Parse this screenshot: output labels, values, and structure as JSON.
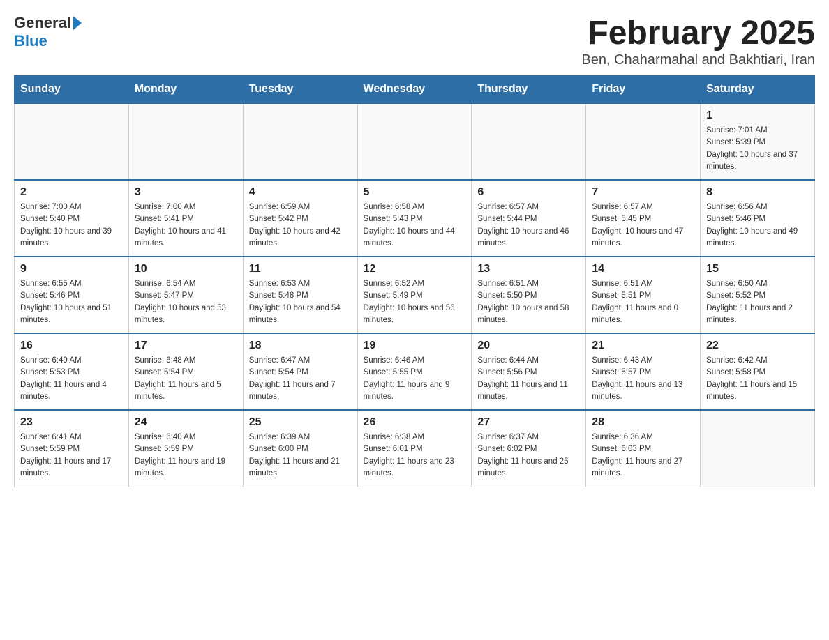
{
  "header": {
    "logo_general": "General",
    "logo_blue": "Blue",
    "month_title": "February 2025",
    "subtitle": "Ben, Chaharmahal and Bakhtiari, Iran"
  },
  "weekdays": [
    "Sunday",
    "Monday",
    "Tuesday",
    "Wednesday",
    "Thursday",
    "Friday",
    "Saturday"
  ],
  "weeks": [
    [
      {
        "day": "",
        "sunrise": "",
        "sunset": "",
        "daylight": ""
      },
      {
        "day": "",
        "sunrise": "",
        "sunset": "",
        "daylight": ""
      },
      {
        "day": "",
        "sunrise": "",
        "sunset": "",
        "daylight": ""
      },
      {
        "day": "",
        "sunrise": "",
        "sunset": "",
        "daylight": ""
      },
      {
        "day": "",
        "sunrise": "",
        "sunset": "",
        "daylight": ""
      },
      {
        "day": "",
        "sunrise": "",
        "sunset": "",
        "daylight": ""
      },
      {
        "day": "1",
        "sunrise": "Sunrise: 7:01 AM",
        "sunset": "Sunset: 5:39 PM",
        "daylight": "Daylight: 10 hours and 37 minutes."
      }
    ],
    [
      {
        "day": "2",
        "sunrise": "Sunrise: 7:00 AM",
        "sunset": "Sunset: 5:40 PM",
        "daylight": "Daylight: 10 hours and 39 minutes."
      },
      {
        "day": "3",
        "sunrise": "Sunrise: 7:00 AM",
        "sunset": "Sunset: 5:41 PM",
        "daylight": "Daylight: 10 hours and 41 minutes."
      },
      {
        "day": "4",
        "sunrise": "Sunrise: 6:59 AM",
        "sunset": "Sunset: 5:42 PM",
        "daylight": "Daylight: 10 hours and 42 minutes."
      },
      {
        "day": "5",
        "sunrise": "Sunrise: 6:58 AM",
        "sunset": "Sunset: 5:43 PM",
        "daylight": "Daylight: 10 hours and 44 minutes."
      },
      {
        "day": "6",
        "sunrise": "Sunrise: 6:57 AM",
        "sunset": "Sunset: 5:44 PM",
        "daylight": "Daylight: 10 hours and 46 minutes."
      },
      {
        "day": "7",
        "sunrise": "Sunrise: 6:57 AM",
        "sunset": "Sunset: 5:45 PM",
        "daylight": "Daylight: 10 hours and 47 minutes."
      },
      {
        "day": "8",
        "sunrise": "Sunrise: 6:56 AM",
        "sunset": "Sunset: 5:46 PM",
        "daylight": "Daylight: 10 hours and 49 minutes."
      }
    ],
    [
      {
        "day": "9",
        "sunrise": "Sunrise: 6:55 AM",
        "sunset": "Sunset: 5:46 PM",
        "daylight": "Daylight: 10 hours and 51 minutes."
      },
      {
        "day": "10",
        "sunrise": "Sunrise: 6:54 AM",
        "sunset": "Sunset: 5:47 PM",
        "daylight": "Daylight: 10 hours and 53 minutes."
      },
      {
        "day": "11",
        "sunrise": "Sunrise: 6:53 AM",
        "sunset": "Sunset: 5:48 PM",
        "daylight": "Daylight: 10 hours and 54 minutes."
      },
      {
        "day": "12",
        "sunrise": "Sunrise: 6:52 AM",
        "sunset": "Sunset: 5:49 PM",
        "daylight": "Daylight: 10 hours and 56 minutes."
      },
      {
        "day": "13",
        "sunrise": "Sunrise: 6:51 AM",
        "sunset": "Sunset: 5:50 PM",
        "daylight": "Daylight: 10 hours and 58 minutes."
      },
      {
        "day": "14",
        "sunrise": "Sunrise: 6:51 AM",
        "sunset": "Sunset: 5:51 PM",
        "daylight": "Daylight: 11 hours and 0 minutes."
      },
      {
        "day": "15",
        "sunrise": "Sunrise: 6:50 AM",
        "sunset": "Sunset: 5:52 PM",
        "daylight": "Daylight: 11 hours and 2 minutes."
      }
    ],
    [
      {
        "day": "16",
        "sunrise": "Sunrise: 6:49 AM",
        "sunset": "Sunset: 5:53 PM",
        "daylight": "Daylight: 11 hours and 4 minutes."
      },
      {
        "day": "17",
        "sunrise": "Sunrise: 6:48 AM",
        "sunset": "Sunset: 5:54 PM",
        "daylight": "Daylight: 11 hours and 5 minutes."
      },
      {
        "day": "18",
        "sunrise": "Sunrise: 6:47 AM",
        "sunset": "Sunset: 5:54 PM",
        "daylight": "Daylight: 11 hours and 7 minutes."
      },
      {
        "day": "19",
        "sunrise": "Sunrise: 6:46 AM",
        "sunset": "Sunset: 5:55 PM",
        "daylight": "Daylight: 11 hours and 9 minutes."
      },
      {
        "day": "20",
        "sunrise": "Sunrise: 6:44 AM",
        "sunset": "Sunset: 5:56 PM",
        "daylight": "Daylight: 11 hours and 11 minutes."
      },
      {
        "day": "21",
        "sunrise": "Sunrise: 6:43 AM",
        "sunset": "Sunset: 5:57 PM",
        "daylight": "Daylight: 11 hours and 13 minutes."
      },
      {
        "day": "22",
        "sunrise": "Sunrise: 6:42 AM",
        "sunset": "Sunset: 5:58 PM",
        "daylight": "Daylight: 11 hours and 15 minutes."
      }
    ],
    [
      {
        "day": "23",
        "sunrise": "Sunrise: 6:41 AM",
        "sunset": "Sunset: 5:59 PM",
        "daylight": "Daylight: 11 hours and 17 minutes."
      },
      {
        "day": "24",
        "sunrise": "Sunrise: 6:40 AM",
        "sunset": "Sunset: 5:59 PM",
        "daylight": "Daylight: 11 hours and 19 minutes."
      },
      {
        "day": "25",
        "sunrise": "Sunrise: 6:39 AM",
        "sunset": "Sunset: 6:00 PM",
        "daylight": "Daylight: 11 hours and 21 minutes."
      },
      {
        "day": "26",
        "sunrise": "Sunrise: 6:38 AM",
        "sunset": "Sunset: 6:01 PM",
        "daylight": "Daylight: 11 hours and 23 minutes."
      },
      {
        "day": "27",
        "sunrise": "Sunrise: 6:37 AM",
        "sunset": "Sunset: 6:02 PM",
        "daylight": "Daylight: 11 hours and 25 minutes."
      },
      {
        "day": "28",
        "sunrise": "Sunrise: 6:36 AM",
        "sunset": "Sunset: 6:03 PM",
        "daylight": "Daylight: 11 hours and 27 minutes."
      },
      {
        "day": "",
        "sunrise": "",
        "sunset": "",
        "daylight": ""
      }
    ]
  ]
}
